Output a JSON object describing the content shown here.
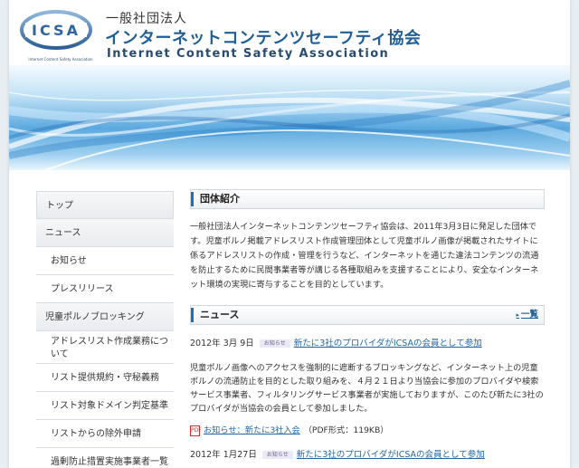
{
  "header": {
    "logo_text": "ICSA",
    "logo_sub": "Internet Content Safety Association",
    "org_kind": "一般社団法人",
    "org_name": "インターネットコンテンツセーフティ協会",
    "org_name_en": "Internet Content Safety Association"
  },
  "nav": {
    "items": [
      {
        "label": "トップ"
      },
      {
        "label": "ニュース"
      },
      {
        "label": "お知らせ"
      },
      {
        "label": "プレスリリース"
      },
      {
        "label": "児童ポルノブロッキング"
      },
      {
        "label": "アドレスリスト作成業務について"
      },
      {
        "label": "リスト提供規約・守秘義務"
      },
      {
        "label": "リスト対象ドメイン判定基準"
      },
      {
        "label": "リストからの除外申請"
      },
      {
        "label": "過剰防止措置実施事業者一覧"
      }
    ]
  },
  "main": {
    "intro_title": "団体紹介",
    "intro_text": "一般社団法人インターネットコンテンツセーフティ協会は、2011年3月3日に発足した団体です。児童ポルノ掲載アドレスリスト作成管理団体として児童ポルノ画像が掲載されたサイトに係るアドレスリストの作成・管理を行うなど、インターネットを通じた違法コンテンツの流通を防止するために民間事業者等が講じる各種取組みを支援することにより、安全なインターネット環境の実現に寄与することを目的としています。",
    "news_title": "ニュース",
    "news_more": "一覧",
    "news": [
      {
        "date": "2012年 3月 9日",
        "badge": "お知らせ",
        "title": "新たに3社のプロバイダがICSAの会員として参加",
        "body": "児童ポルノ画像へのアクセスを強制的に遮断するブロッキングなど、インターネット上の児童ポルノの流通防止を目的とした取り組みを、４月２１日より当協会に参加のプロバイダや検索サービス事業者、フィルタリングサービス事業者が実施しておりますが、このたび新たに3社のプロバイダが当協会の会員として参加しました。",
        "attachment": "お知らせ：新たに3社入会",
        "attachment_info": "（PDF形式：119KB）"
      },
      {
        "date": "2012年 1月27日",
        "badge": "お知らせ",
        "title": "新たに3社のプロバイダがICSAの会員として参加"
      }
    ]
  },
  "colors": {
    "accent": "#1f5f97",
    "link": "#2266a8",
    "badge_bg": "#ebe9f3"
  },
  "icons": [
    "logo-ring-icon",
    "more-arrow-icon",
    "pdf-icon"
  ]
}
